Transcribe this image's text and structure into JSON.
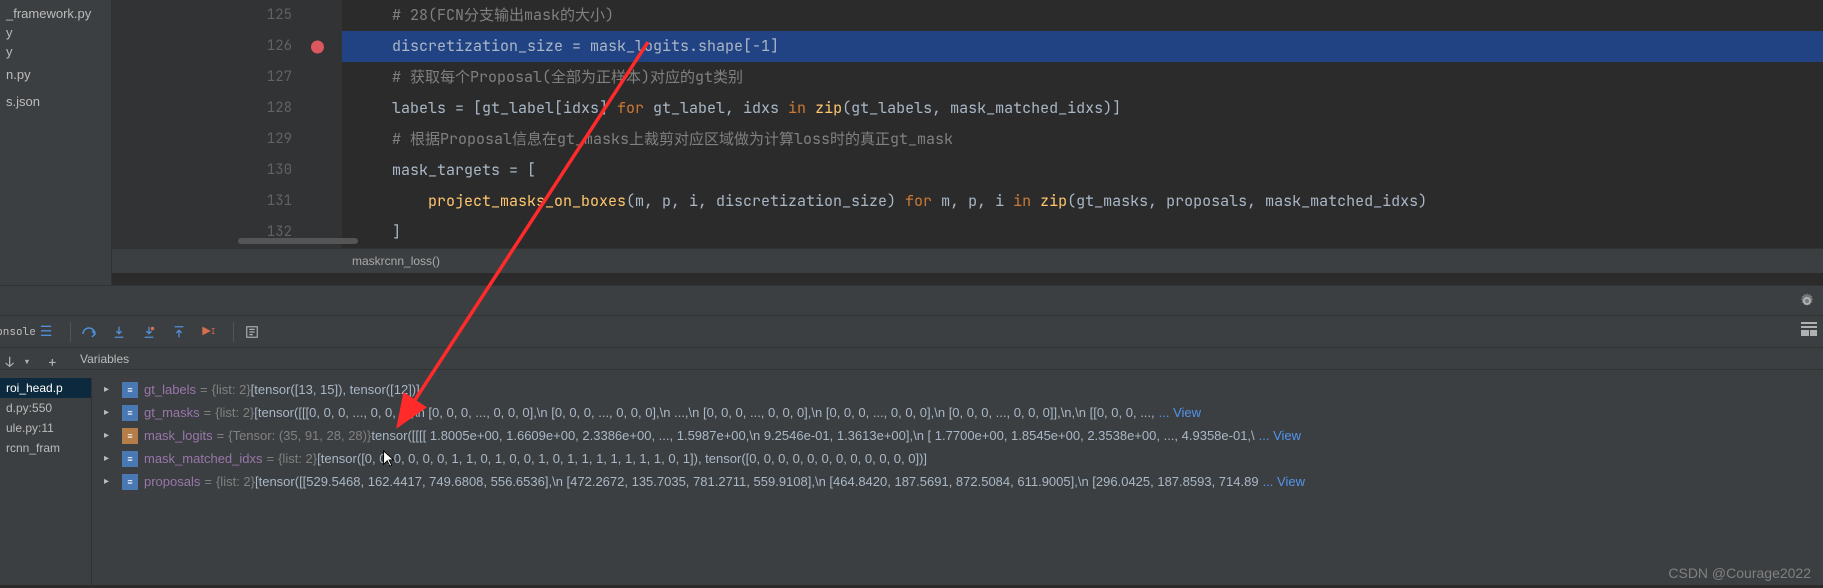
{
  "file_tree": {
    "items": [
      "_framework.py",
      "y",
      "y",
      "",
      "n.py",
      "",
      "",
      "s.json",
      ""
    ]
  },
  "editor": {
    "breadcrumb": "maskrcnn_loss()",
    "lines": [
      {
        "num": "125",
        "bp": false,
        "hl": false,
        "segs": [
          {
            "cls": "cmt",
            "t": "# 28(FCN分支输出mask的大小)"
          }
        ]
      },
      {
        "num": "126",
        "bp": true,
        "hl": true,
        "segs": [
          {
            "cls": "param",
            "t": "discretization_size = mask_logits.shape[-1]"
          }
        ]
      },
      {
        "num": "127",
        "bp": false,
        "hl": false,
        "segs": [
          {
            "cls": "cmt",
            "t": "# 获取每个Proposal(全部为正样本)对应的gt类别"
          }
        ]
      },
      {
        "num": "128",
        "bp": false,
        "hl": false,
        "segs": [
          {
            "cls": "param",
            "t": "labels = [gt_label[idxs] "
          },
          {
            "cls": "kw",
            "t": "for"
          },
          {
            "cls": "param",
            "t": " gt_label, idxs "
          },
          {
            "cls": "kw",
            "t": "in"
          },
          {
            "cls": "param",
            "t": " "
          },
          {
            "cls": "fn",
            "t": "zip"
          },
          {
            "cls": "param",
            "t": "(gt_labels, mask_matched_idxs)]"
          }
        ]
      },
      {
        "num": "129",
        "bp": false,
        "hl": false,
        "segs": [
          {
            "cls": "cmt",
            "t": "# 根据Proposal信息在gt_masks上裁剪对应区域做为计算loss时的真正gt_mask"
          }
        ]
      },
      {
        "num": "130",
        "bp": false,
        "hl": false,
        "segs": [
          {
            "cls": "param",
            "t": "mask_targets = ["
          }
        ]
      },
      {
        "num": "131",
        "bp": false,
        "hl": false,
        "segs": [
          {
            "cls": "param",
            "t": "    "
          },
          {
            "cls": "fn",
            "t": "project_masks_on_boxes"
          },
          {
            "cls": "param",
            "t": "(m, p, i, discretization_size) "
          },
          {
            "cls": "kw",
            "t": "for"
          },
          {
            "cls": "param",
            "t": " m, p, i "
          },
          {
            "cls": "kw",
            "t": "in"
          },
          {
            "cls": "param",
            "t": " "
          },
          {
            "cls": "fn",
            "t": "zip"
          },
          {
            "cls": "param",
            "t": "(gt_masks, proposals, mask_matched_idxs)"
          }
        ]
      },
      {
        "num": "132",
        "bp": false,
        "hl": false,
        "segs": [
          {
            "cls": "param",
            "t": "]"
          }
        ]
      }
    ]
  },
  "debug": {
    "console_tab": "onsole",
    "variables_label": "Variables",
    "vars": [
      {
        "icon": "list",
        "name": "gt_labels",
        "type": "{list: 2}",
        "val": "[tensor([13, 15]), tensor([12])]"
      },
      {
        "icon": "list",
        "name": "gt_masks",
        "type": "{list: 2}",
        "val": "[tensor([[[0, 0, 0,  ..., 0, 0, 0],\\n        [0, 0, 0,  ..., 0, 0, 0],\\n        [0, 0, 0,  ..., 0, 0, 0],\\n        ...,\\n        [0, 0, 0,  ..., 0, 0, 0],\\n        [0, 0, 0,  ..., 0, 0, 0],\\n        [0, 0, 0,  ..., 0, 0, 0]],\\n,\\n       [[0, 0, 0,  ...,",
        "view": "View"
      },
      {
        "icon": "tensor",
        "name": "mask_logits",
        "type": "{Tensor: (35, 91, 28, 28)}",
        "val": "tensor([[[[ 1.8005e+00,  1.6609e+00,  2.3386e+00,  ...,  1.5987e+00,\\n           9.2546e-01,  1.3613e+00],\\n          [ 1.7700e+00,  1.8545e+00,  2.3538e+00,  ...,  4.9358e-01,\\",
        "view": "View"
      },
      {
        "icon": "list",
        "name": "mask_matched_idxs",
        "type": "{list: 2}",
        "val": "[tensor([0, 0, 0, 0, 0, 0, 1, 1, 0, 1, 0, 0, 1, 0, 1, 1, 1, 1, 1, 1, 1, 0, 1]), tensor([0, 0, 0, 0, 0, 0, 0, 0, 0, 0, 0, 0])]"
      },
      {
        "icon": "list",
        "name": "proposals",
        "type": "{list: 2}",
        "val": "[tensor([[529.5468, 162.4417, 749.6808, 556.6536],\\n        [472.2672, 135.7035, 781.2711, 559.9108],\\n        [464.8420, 187.5691, 872.5084, 611.9005],\\n        [296.0425, 187.8593, 714.89",
        "view": "View"
      }
    ]
  },
  "frames": {
    "items": [
      "roi_head.p",
      "d.py:550",
      "ule.py:11",
      "rcnn_fram"
    ]
  },
  "watermark": "CSDN @Courage2022"
}
